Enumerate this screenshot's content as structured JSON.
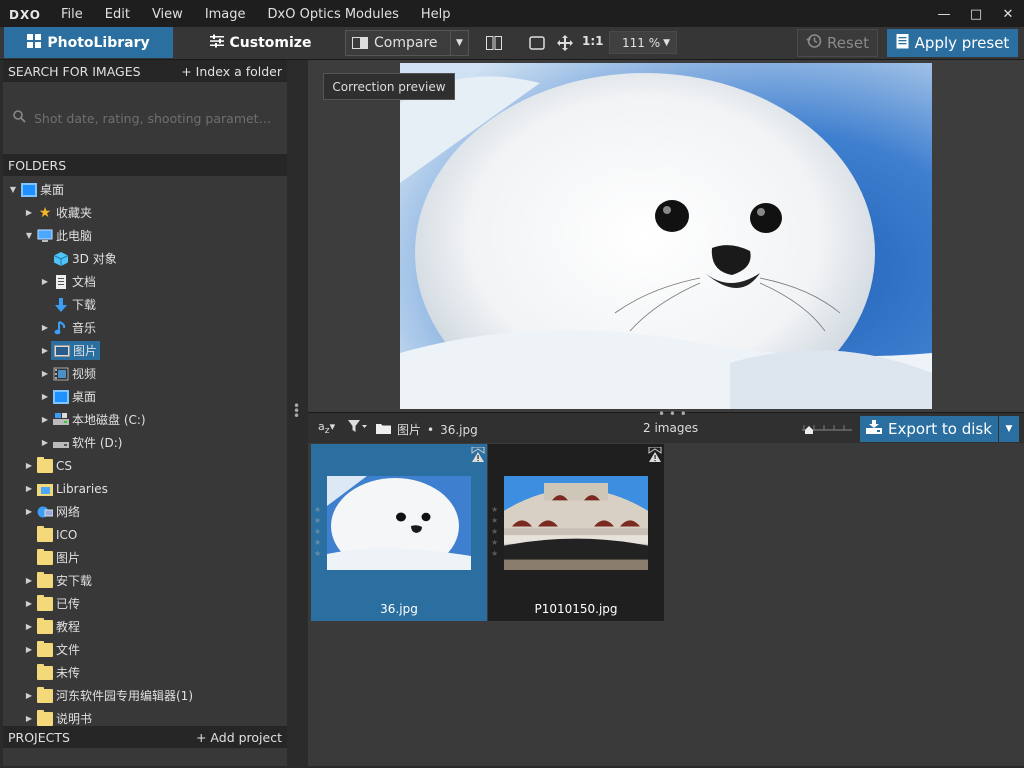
{
  "menubar": {
    "logo": "DXO",
    "items": [
      "File",
      "Edit",
      "View",
      "Image",
      "DxO Optics Modules",
      "Help"
    ],
    "window_controls": [
      "minimize-icon",
      "maximize-icon",
      "close-icon"
    ]
  },
  "toolbar": {
    "photolibrary_label": "PhotoLibrary",
    "customize_label": "Customize",
    "compare_label": "Compare",
    "one_to_one": "1:1",
    "zoom_value": "111 %",
    "reset_label": "Reset",
    "apply_preset_label": "Apply preset"
  },
  "search": {
    "header": "SEARCH FOR IMAGES",
    "index_link": "+ Index a folder",
    "placeholder": "Shot date, rating, shooting parameters..."
  },
  "folders": {
    "header": "FOLDERS",
    "items": [
      {
        "label": "桌面",
        "icon": "monitor-icon",
        "arrow": "▼"
      },
      {
        "label": "收藏夹",
        "icon": "star-icon",
        "arrow": "▶"
      },
      {
        "label": "此电脑",
        "icon": "pc-icon",
        "arrow": "▼"
      },
      {
        "label": "3D 对象",
        "icon": "cube-icon",
        "arrow": ""
      },
      {
        "label": "文档",
        "icon": "document-icon",
        "arrow": "▶"
      },
      {
        "label": "下载",
        "icon": "download-icon",
        "arrow": ""
      },
      {
        "label": "音乐",
        "icon": "music-icon",
        "arrow": "▶"
      },
      {
        "label": "图片",
        "icon": "picture-icon",
        "arrow": "▶"
      },
      {
        "label": "视频",
        "icon": "video-icon",
        "arrow": "▶"
      },
      {
        "label": "桌面",
        "icon": "monitor-icon",
        "arrow": "▶"
      },
      {
        "label": "本地磁盘 (C:)",
        "icon": "drive-icon",
        "arrow": "▶"
      },
      {
        "label": "软件 (D:)",
        "icon": "drive-icon",
        "arrow": "▶"
      },
      {
        "label": "CS",
        "icon": "folder-icon",
        "arrow": "▶"
      },
      {
        "label": "Libraries",
        "icon": "libraries-icon",
        "arrow": "▶"
      },
      {
        "label": "网络",
        "icon": "network-icon",
        "arrow": "▶"
      },
      {
        "label": "ICO",
        "icon": "folder-icon",
        "arrow": ""
      },
      {
        "label": "图片",
        "icon": "folder-icon",
        "arrow": ""
      },
      {
        "label": "安下载",
        "icon": "folder-icon",
        "arrow": "▶"
      },
      {
        "label": "已传",
        "icon": "folder-icon",
        "arrow": "▶"
      },
      {
        "label": "教程",
        "icon": "folder-icon",
        "arrow": "▶"
      },
      {
        "label": "文件",
        "icon": "folder-icon",
        "arrow": "▶"
      },
      {
        "label": "未传",
        "icon": "folder-icon",
        "arrow": ""
      },
      {
        "label": "河东软件园专用编辑器(1)",
        "icon": "folder-icon",
        "arrow": "▶"
      },
      {
        "label": "说明书",
        "icon": "folder-icon",
        "arrow": "▶"
      }
    ]
  },
  "projects": {
    "header": "PROJECTS",
    "add_link": "+ Add project"
  },
  "preview": {
    "correction_preview_label": "Correction preview"
  },
  "filmbar": {
    "folder_name": "图片",
    "separator": "•",
    "file_name": "36.jpg",
    "count": "2 images",
    "export_label": "Export to disk"
  },
  "thumbnails": [
    {
      "name": "36.jpg"
    },
    {
      "name": "P1010150.jpg"
    }
  ],
  "colors": {
    "accent": "#2a6fa0",
    "panel": "#383838",
    "header": "#262626"
  }
}
